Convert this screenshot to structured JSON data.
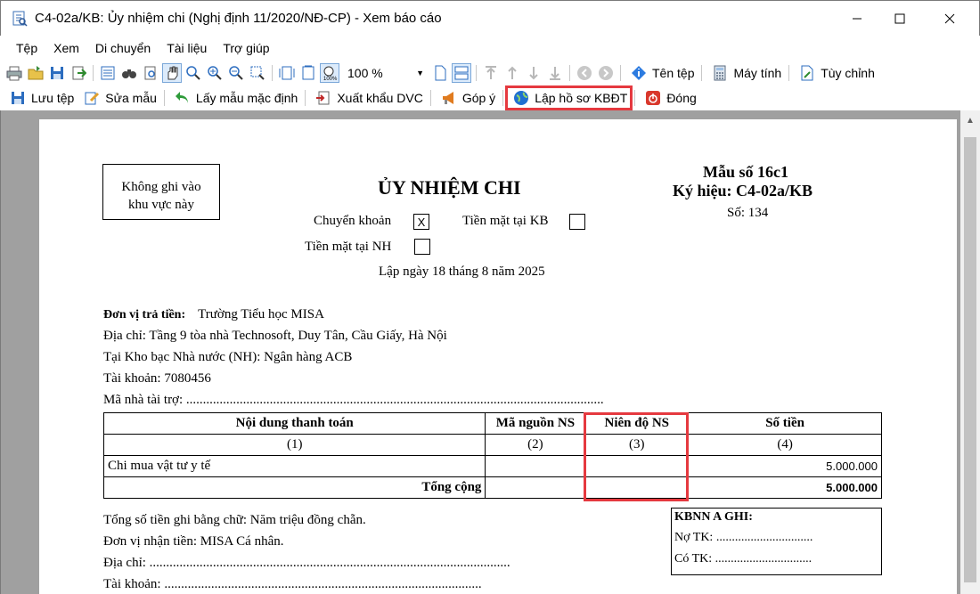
{
  "window": {
    "title": "C4-02a/KB: Ủy nhiệm chi (Nghị định 11/2020/NĐ-CP) - Xem báo cáo"
  },
  "menu": [
    "Tệp",
    "Xem",
    "Di chuyển",
    "Tài liệu",
    "Trợ giúp"
  ],
  "toolbar1": {
    "zoom_value": "100 %",
    "file_name_label": "Tên tệp",
    "calculator_label": "Máy tính",
    "customize_label": "Tùy chỉnh"
  },
  "toolbar2": {
    "save_label": "Lưu tệp",
    "edit_template_label": "Sửa mẫu",
    "default_template_label": "Lấy mẫu mặc định",
    "export_dvc_label": "Xuất khẩu DVC",
    "feedback_label": "Góp ý",
    "create_kbdt_label": "Lập hồ sơ KBĐT",
    "close_label": "Đóng"
  },
  "doc": {
    "no_write_box": [
      "Không ghi vào",
      "khu vực này"
    ],
    "title": "ỦY NHIỆM CHI",
    "form_no": "Mẫu số 16c1",
    "symbol": "Ký hiệu: C4-02a/KB",
    "number": "Số: 134",
    "transfer_label": "Chuyển khoản",
    "transfer_mark": "X",
    "cash_kb_label": "Tiền mặt tại KB",
    "cash_nh_label": "Tiền mặt tại NH",
    "date": "Lập ngày 18 tháng 8 năm 2025",
    "payer_label": "Đơn vị trả tiền:",
    "payer_value": "Trường Tiểu học MISA",
    "address": "Địa chỉ: Tầng 9 tòa nhà Technosoft, Duy Tân, Cầu Giấy, Hà Nội",
    "treasury": "Tại Kho bạc Nhà nước (NH): Ngân hàng ACB",
    "account": "Tài khoản: 7080456",
    "sponsor": "Mã  nhà  tài  trợ:  .............................................................................................................................",
    "table": {
      "headers": [
        "Nội dung thanh toán",
        "Mã nguồn NS",
        "Niên độ NS",
        "Số tiền"
      ],
      "col_numbers": [
        "(1)",
        "(2)",
        "(3)",
        "(4)"
      ],
      "rows": [
        {
          "content": "Chi mua vật tư y tế",
          "source": "",
          "year": "",
          "amount": "5.000.000"
        }
      ],
      "total_label": "Tổng cộng",
      "total_amount": "5.000.000"
    },
    "amount_words": "Tổng số tiền ghi bằng chữ: Năm triệu đồng chẵn.",
    "receiver": "Đơn vị nhận tiền: MISA Cá nhân.",
    "receiver_address": "Địa  chỉ:  ............................................................................................................",
    "receiver_account": "Tài  khoản:  ...............................................................................................",
    "kbnn": {
      "title": "KBNN A GHI:",
      "debit": "Nợ TK: ...............................",
      "credit": "Có TK: ..............................."
    }
  }
}
